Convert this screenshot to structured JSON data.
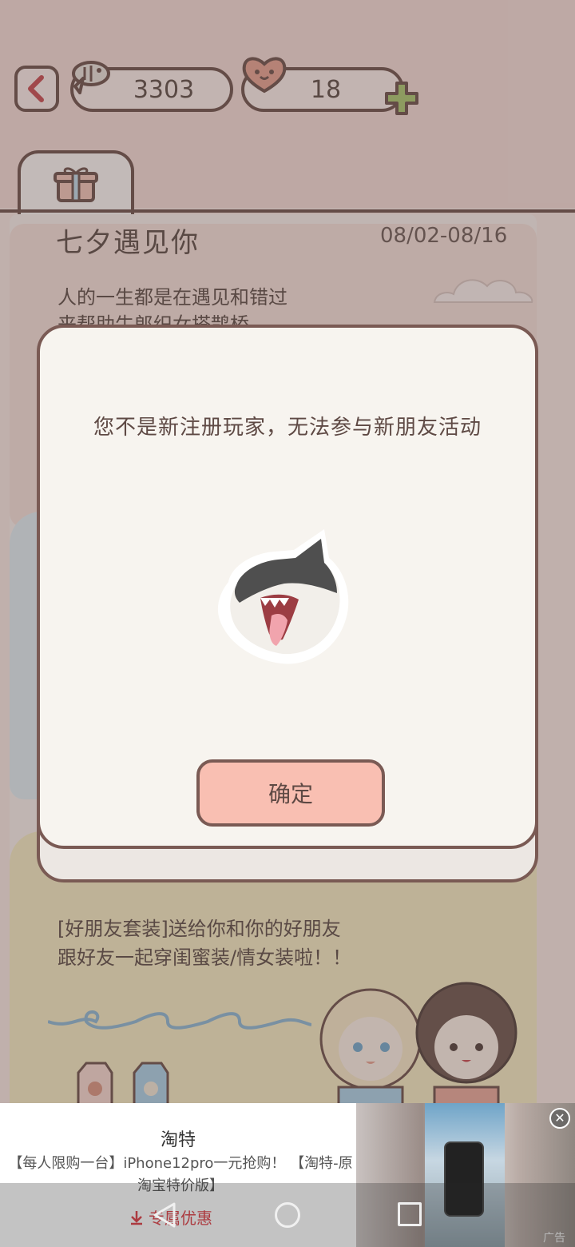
{
  "header": {
    "fish_count": "3303",
    "heart_count": "18"
  },
  "event": {
    "title": "七夕遇见你",
    "date": "08/02-08/16",
    "desc_line1": "人的一生都是在遇见和错过",
    "desc_line2": "来帮助牛郎织女搭鹊桥"
  },
  "suit": {
    "line1": "[好朋友套装]送给你和你的好朋友",
    "line2": "跟好友一起穿闺蜜装/情女装啦！！"
  },
  "dialog": {
    "message": "您不是新注册玩家，无法参与新朋友活动",
    "confirm_label": "确定"
  },
  "ad": {
    "title": "淘特",
    "description": "【每人限购一台】iPhone12pro一元抢购！ 【淘特-原淘宝特价版】",
    "cta_label": "专属优惠",
    "tag": "广告",
    "close_label": "✕"
  },
  "colors": {
    "accent_brown": "#6b4a44",
    "button_pink": "#f9bfb2",
    "ad_cta_red": "#e0434a"
  }
}
